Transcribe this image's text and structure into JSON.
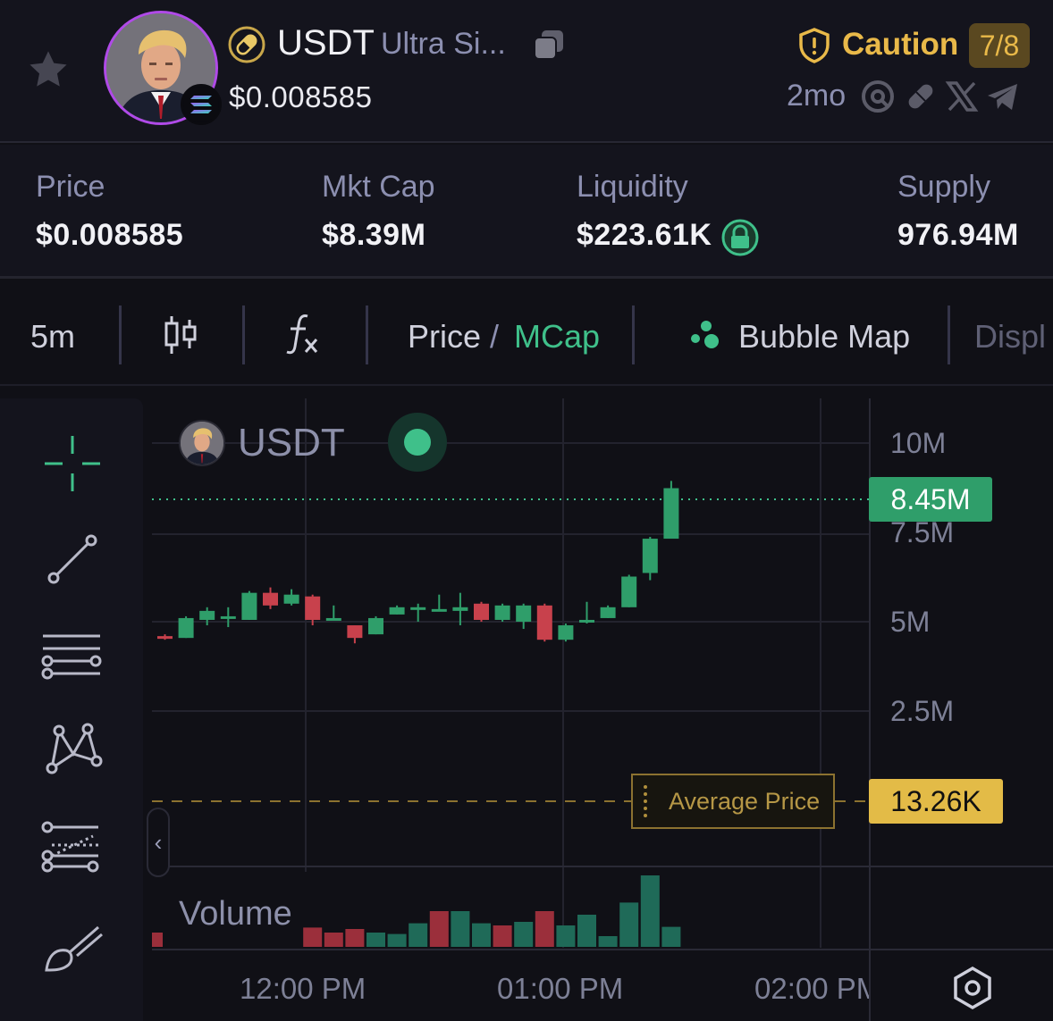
{
  "header": {
    "symbol": "USDT",
    "name": "Ultra Si...",
    "price": "$0.008585",
    "risk_label": "Caution",
    "risk_score": "7/8",
    "age": "2mo",
    "icons": [
      "star-icon",
      "pill-icon",
      "solana-icon",
      "copy-icon",
      "shield-icon",
      "search-icon",
      "link-icon",
      "x-icon",
      "telegram-icon"
    ]
  },
  "stats": [
    {
      "label": "Price",
      "value": "$0.008585"
    },
    {
      "label": "Mkt Cap",
      "value": "$8.39M"
    },
    {
      "label": "Liquidity",
      "value": "$223.61K"
    },
    {
      "label": "Supply",
      "value": "976.94M"
    }
  ],
  "toolbar": {
    "interval": "5m",
    "price_label": "Price",
    "divider": "/",
    "mcap_label": "MCap",
    "bubble_map": "Bubble Map",
    "display": "Displ"
  },
  "chart": {
    "legend_symbol": "USDT",
    "volume_label": "Volume",
    "current_tag": "8.45M",
    "avg_tag": "13.26K",
    "avg_label": "Average Price",
    "colors": {
      "up": "#2f9e6a",
      "down": "#c8414c",
      "volume_up": "#1f6a58",
      "volume_down": "#9b2f3b",
      "avg": "#e3bb47"
    }
  },
  "chart_data": {
    "type": "candlestick",
    "y_ticks": [
      "10M",
      "7.5M",
      "5M",
      "2.5M"
    ],
    "x_ticks": [
      "12:00 PM",
      "01:00 PM",
      "02:00 PM"
    ],
    "ylim": [
      0,
      11000000
    ],
    "current_value": 8450000,
    "average_price": "13.26K",
    "candles": [
      {
        "open": 4.65,
        "close": 4.6,
        "high": 4.7,
        "low": 4.55
      },
      {
        "open": 4.6,
        "close": 5.15,
        "high": 5.2,
        "low": 4.6
      },
      {
        "open": 5.1,
        "close": 5.35,
        "high": 5.45,
        "low": 4.95
      },
      {
        "open": 5.2,
        "close": 5.2,
        "high": 5.45,
        "low": 4.9
      },
      {
        "open": 5.1,
        "close": 5.85,
        "high": 5.9,
        "low": 5.1
      },
      {
        "open": 5.85,
        "close": 5.5,
        "high": 6.0,
        "low": 5.4
      },
      {
        "open": 5.55,
        "close": 5.8,
        "high": 5.95,
        "low": 5.5
      },
      {
        "open": 5.75,
        "close": 5.1,
        "high": 5.8,
        "low": 4.95
      },
      {
        "open": 5.15,
        "close": 5.15,
        "high": 5.5,
        "low": 5.1
      },
      {
        "open": 4.95,
        "close": 4.6,
        "high": 4.95,
        "low": 4.45
      },
      {
        "open": 4.7,
        "close": 5.15,
        "high": 5.2,
        "low": 4.7
      },
      {
        "open": 5.25,
        "close": 5.45,
        "high": 5.5,
        "low": 5.25
      },
      {
        "open": 5.4,
        "close": 5.45,
        "high": 5.55,
        "low": 5.05
      },
      {
        "open": 5.4,
        "close": 5.4,
        "high": 5.8,
        "low": 5.35
      },
      {
        "open": 5.35,
        "close": 5.45,
        "high": 5.85,
        "low": 4.95
      },
      {
        "open": 5.55,
        "close": 5.1,
        "high": 5.6,
        "low": 5.05
      },
      {
        "open": 5.1,
        "close": 5.5,
        "high": 5.55,
        "low": 5.05
      },
      {
        "open": 5.05,
        "close": 5.5,
        "high": 5.55,
        "low": 4.85
      },
      {
        "open": 5.5,
        "close": 4.55,
        "high": 5.55,
        "low": 4.5
      },
      {
        "open": 4.55,
        "close": 4.95,
        "high": 5.0,
        "low": 4.5
      },
      {
        "open": 5.1,
        "close": 5.1,
        "high": 5.6,
        "low": 5.0
      },
      {
        "open": 5.15,
        "close": 5.45,
        "high": 5.5,
        "low": 5.15
      },
      {
        "open": 5.45,
        "close": 6.3,
        "high": 6.35,
        "low": 5.45
      },
      {
        "open": 6.4,
        "close": 7.35,
        "high": 7.4,
        "low": 6.2
      },
      {
        "open": 7.35,
        "close": 8.75,
        "high": 8.95,
        "low": 7.35
      }
    ],
    "volume": [
      {
        "v": 0.2,
        "dir": "down"
      },
      {
        "v": 0.0,
        "dir": "up"
      },
      {
        "v": 0.0,
        "dir": "up"
      },
      {
        "v": 0.0,
        "dir": "up"
      },
      {
        "v": 0.0,
        "dir": "up"
      },
      {
        "v": 0.0,
        "dir": "up"
      },
      {
        "v": 0.0,
        "dir": "up"
      },
      {
        "v": 0.27,
        "dir": "down"
      },
      {
        "v": 0.2,
        "dir": "down"
      },
      {
        "v": 0.25,
        "dir": "down"
      },
      {
        "v": 0.2,
        "dir": "up"
      },
      {
        "v": 0.18,
        "dir": "up"
      },
      {
        "v": 0.33,
        "dir": "up"
      },
      {
        "v": 0.5,
        "dir": "down"
      },
      {
        "v": 0.5,
        "dir": "up"
      },
      {
        "v": 0.33,
        "dir": "up"
      },
      {
        "v": 0.3,
        "dir": "down"
      },
      {
        "v": 0.35,
        "dir": "up"
      },
      {
        "v": 0.5,
        "dir": "down"
      },
      {
        "v": 0.3,
        "dir": "up"
      },
      {
        "v": 0.45,
        "dir": "up"
      },
      {
        "v": 0.15,
        "dir": "up"
      },
      {
        "v": 0.62,
        "dir": "up"
      },
      {
        "v": 1.0,
        "dir": "up"
      },
      {
        "v": 0.28,
        "dir": "up"
      }
    ]
  }
}
